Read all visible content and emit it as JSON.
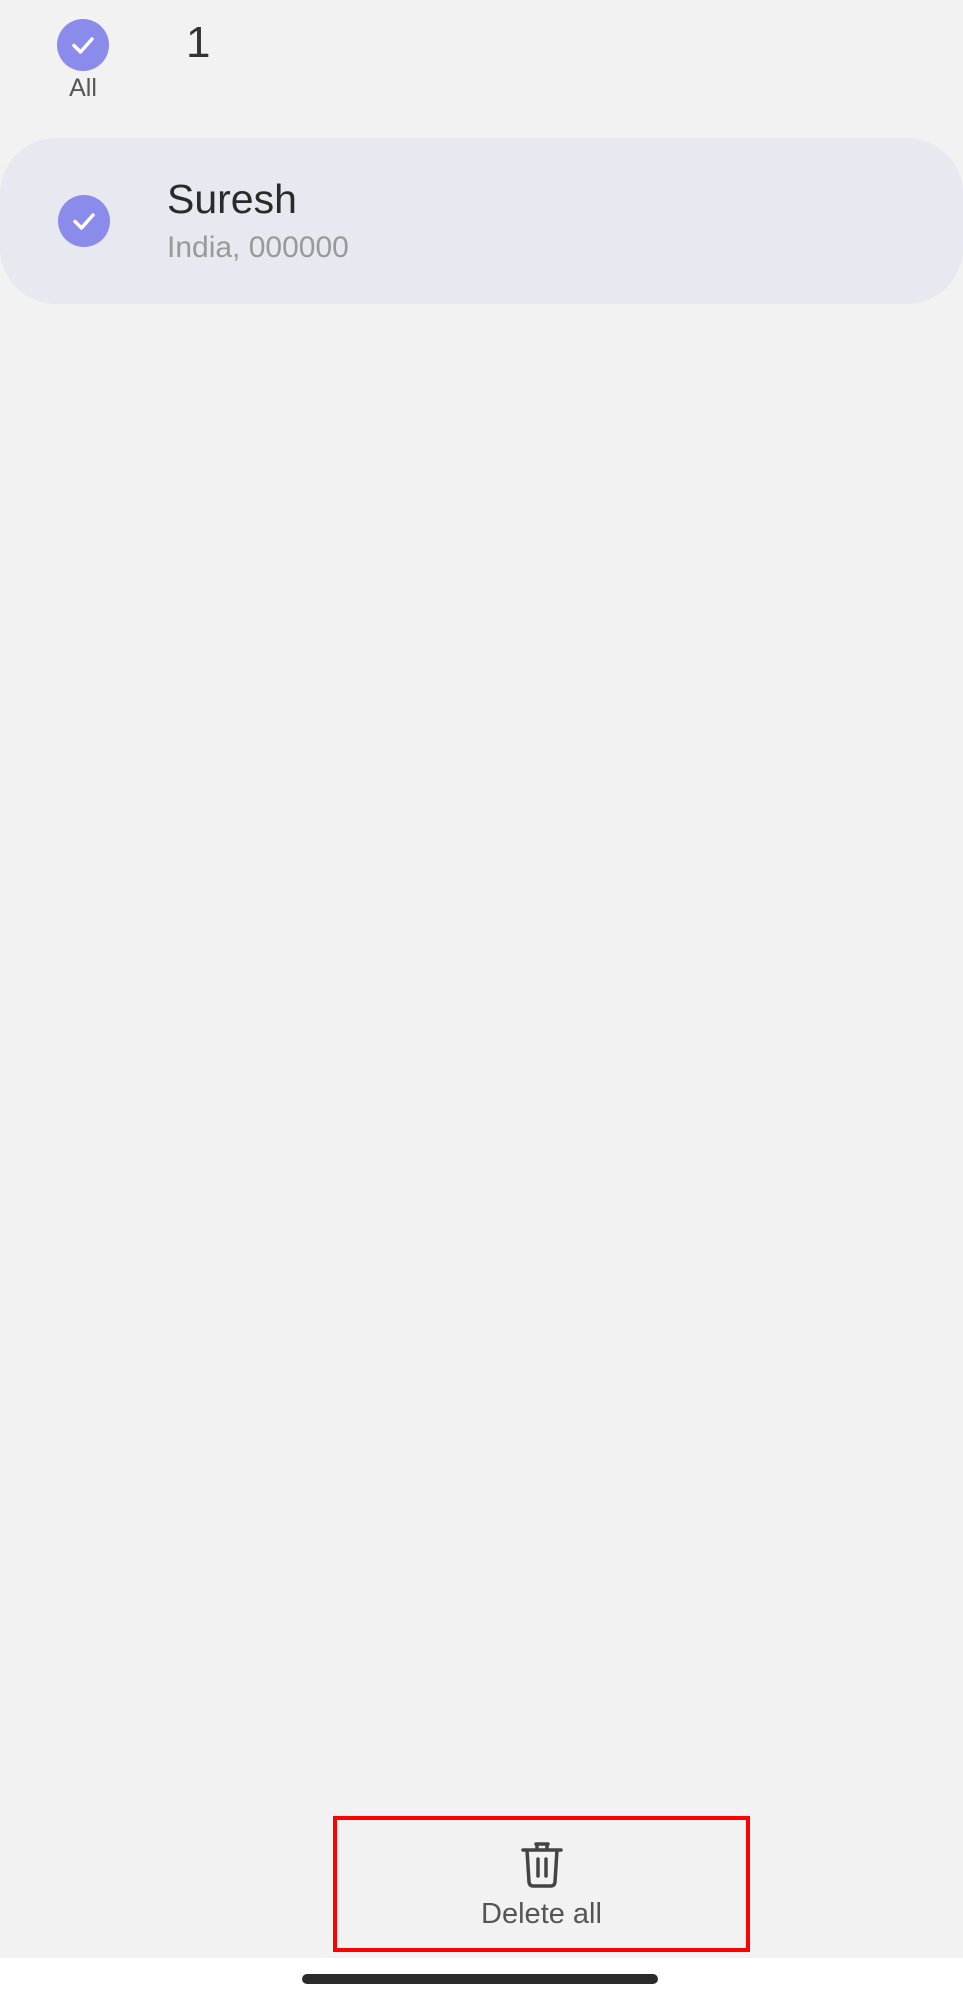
{
  "theme": {
    "accent": "#8b8beb"
  },
  "selection_header": {
    "all_label": "All",
    "selected_count": "1"
  },
  "addresses": [
    {
      "name": "Suresh",
      "detail": "India, 000000",
      "selected": true
    }
  ],
  "bottom_bar": {
    "delete_all_label": "Delete all",
    "delete_icon": "trash-icon"
  }
}
